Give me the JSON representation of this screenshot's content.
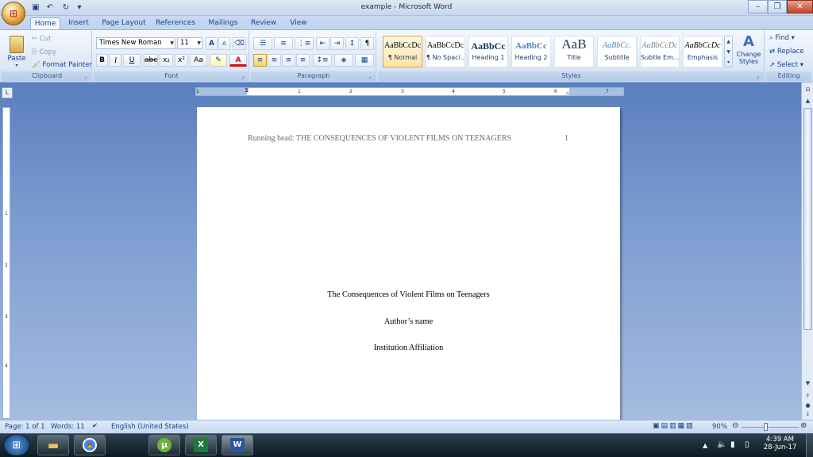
{
  "window": {
    "title": "example - Microsoft Word"
  },
  "tabs": [
    "Home",
    "Insert",
    "Page Layout",
    "References",
    "Mailings",
    "Review",
    "View"
  ],
  "clipboard": {
    "paste": "Paste",
    "cut": "Cut",
    "copy": "Copy",
    "format_painter": "Format Painter",
    "label": "Clipboard"
  },
  "font": {
    "name": "Times New Roman",
    "size": "11",
    "label": "Font",
    "bold": "B",
    "italic": "I",
    "underline": "U",
    "strike": "abc",
    "subscript": "x₂",
    "superscript": "x²",
    "case": "Aa",
    "grow": "A",
    "shrink": "A"
  },
  "paragraph": {
    "label": "Paragraph",
    "pilcrow": "¶"
  },
  "styles": {
    "label": "Styles",
    "items": [
      {
        "preview": "AaBbCcDc",
        "name": "¶ Normal"
      },
      {
        "preview": "AaBbCcDc",
        "name": "¶ No Spaci..."
      },
      {
        "preview": "AaBbCc",
        "name": "Heading 1"
      },
      {
        "preview": "AaBbCc",
        "name": "Heading 2"
      },
      {
        "preview": "AaB",
        "name": "Title"
      },
      {
        "preview": "AaBbCc.",
        "name": "Subtitle"
      },
      {
        "preview": "AaBbCcDc",
        "name": "Subtle Em..."
      },
      {
        "preview": "AaBbCcDc",
        "name": "Emphasis"
      }
    ],
    "change_styles": "Change Styles"
  },
  "editing": {
    "label": "Editing",
    "find": "Find",
    "replace": "Replace",
    "select": "Select"
  },
  "ruler_numbers": [
    "1",
    "1",
    "2",
    "3",
    "4",
    "5",
    "6",
    "7"
  ],
  "vruler_numbers": [
    "1",
    "2",
    "3",
    "4"
  ],
  "document": {
    "header_left": "Running head: THE CONSEQUENCES OF VIOLENT FILMS ON TEENAGERS",
    "header_page": "1",
    "title": "The Consequences  of Violent Films on Teenagers",
    "author": "Author’s name",
    "affiliation": "Institution Affiliation"
  },
  "status": {
    "page": "Page: 1 of 1",
    "words": "Words: 11",
    "language": "English (United States)",
    "zoom": "90%"
  },
  "tray": {
    "time": "4:39 AM",
    "date": "28-Jun-17"
  },
  "colors": {
    "ribbon": "#dce8f6",
    "accent": "#15428b",
    "page": "#ffffff",
    "taskbar": "#1a2a33"
  }
}
